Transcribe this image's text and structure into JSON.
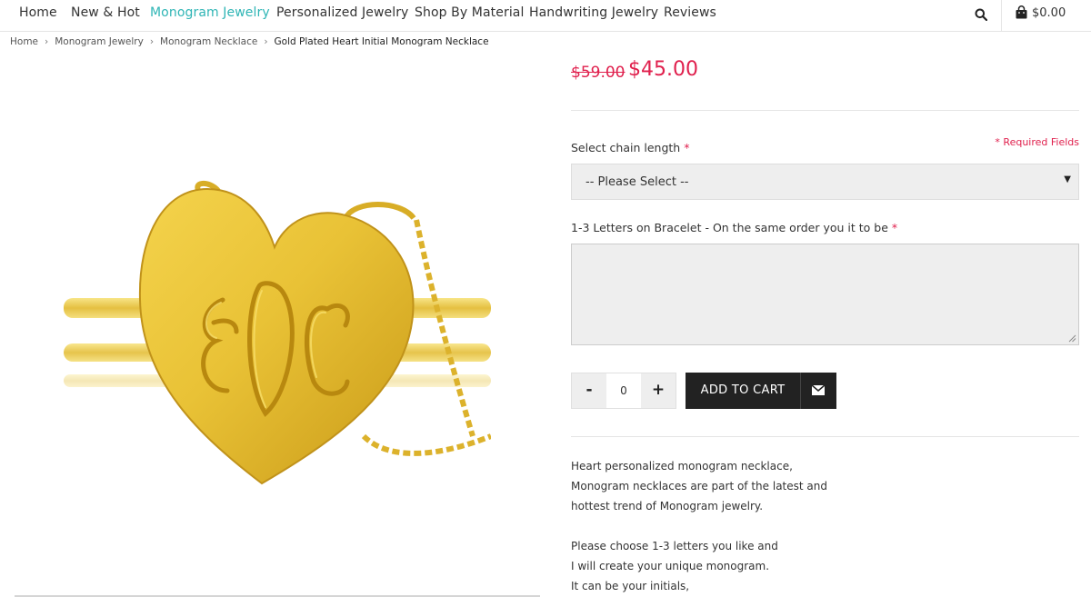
{
  "nav": {
    "items": [
      "Home",
      "New & Hot",
      "Monogram Jewelry",
      "Personalized Jewelry",
      "Shop By Material",
      "Handwriting Jewelry",
      "Reviews"
    ],
    "active": "Monogram Jewelry",
    "cart_total": "$0.00"
  },
  "breadcrumb": {
    "items": [
      "Home",
      "Monogram Jewelry",
      "Monogram Necklace"
    ],
    "current": "Gold Plated Heart Initial Monogram Necklace"
  },
  "product": {
    "price_old": "$59.00",
    "price_new": "$45.00",
    "required_note": "* Required Fields",
    "chain_label": "Select chain length",
    "chain_value": "-- Please Select --",
    "letters_label": "1-3 Letters on Bracelet - On the same order you it to be",
    "required_mark": "*",
    "quantity": "0",
    "minus_label": "-",
    "plus_label": "+",
    "add_to_cart": "ADD TO CART",
    "description_lines": [
      "Heart personalized monogram necklace,",
      "Monogram necklaces are part of the latest and",
      "hottest trend of Monogram jewelry.",
      "",
      "Please choose 1-3 letters you like and",
      "I will create your unique monogram.",
      "It can be your initials,"
    ]
  },
  "colors": {
    "accent": "#2fb5b5",
    "price": "#e0204d",
    "button": "#222222",
    "gold": "#e8c23a"
  },
  "icons": {
    "search": "search-icon",
    "cart": "shopping-bag-icon",
    "email": "envelope-icon",
    "breadcrumb_separator": "chevron-right-icon",
    "select_arrow": "caret-down-icon"
  }
}
